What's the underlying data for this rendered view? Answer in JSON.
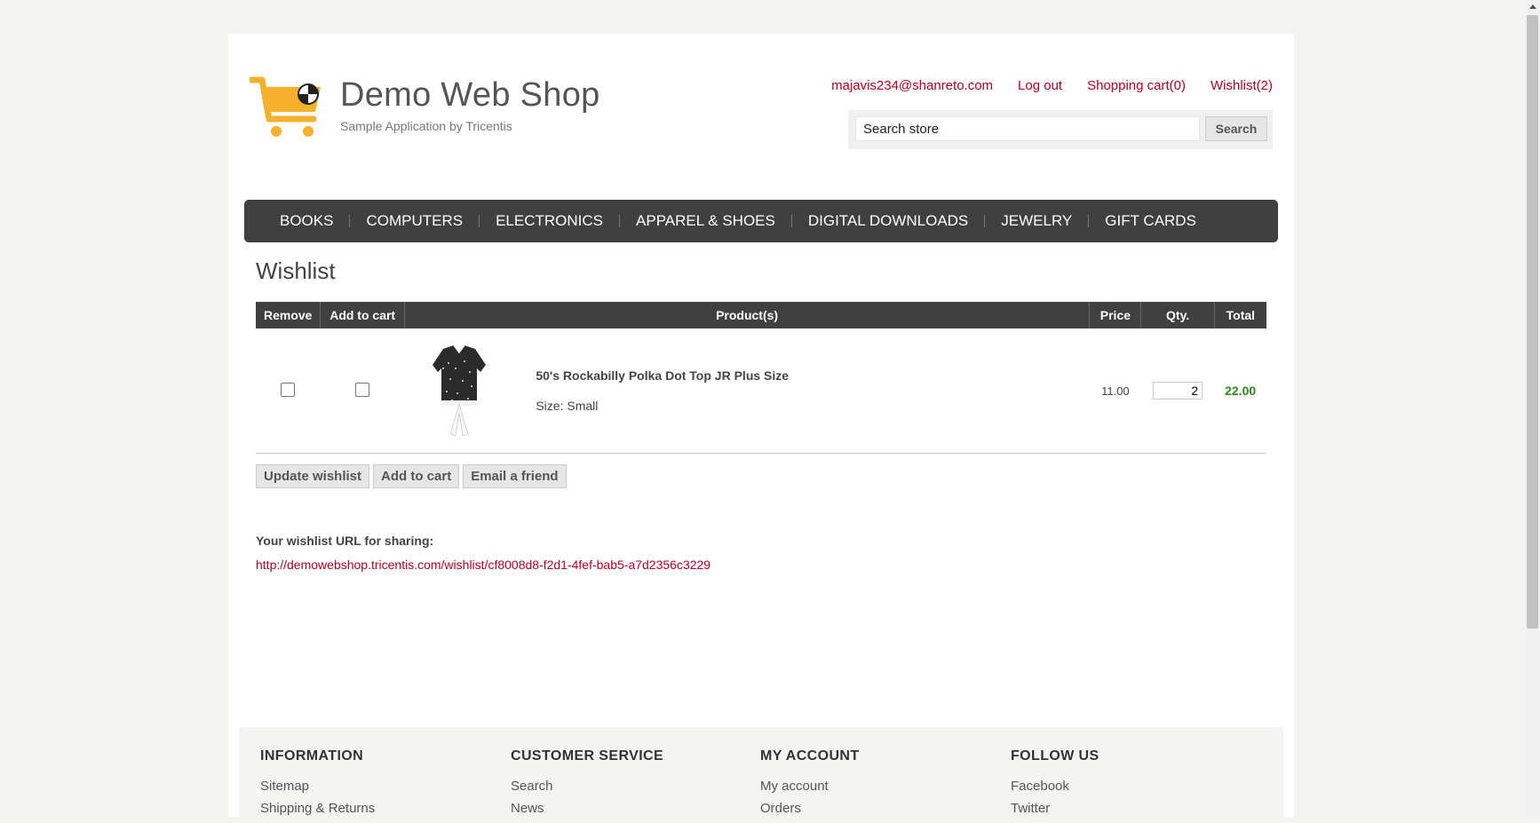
{
  "header": {
    "logo_title": "Demo Web Shop",
    "logo_subtitle": "Sample Application by Tricentis",
    "links": {
      "account": "majavis234@shanreto.com",
      "logout": "Log out",
      "cart": "Shopping cart(0)",
      "wishlist": "Wishlist(2)"
    },
    "search": {
      "value": "Search store",
      "button": "Search"
    }
  },
  "nav": [
    "BOOKS",
    "COMPUTERS",
    "ELECTRONICS",
    "APPAREL & SHOES",
    "DIGITAL DOWNLOADS",
    "JEWELRY",
    "GIFT CARDS"
  ],
  "main": {
    "title": "Wishlist",
    "table": {
      "headers": {
        "remove": "Remove",
        "add_to_cart": "Add to cart",
        "products": "Product(s)",
        "price": "Price",
        "qty": "Qty.",
        "total": "Total"
      },
      "rows": [
        {
          "name": "50's Rockabilly Polka Dot Top JR Plus Size",
          "attribute": "Size: Small",
          "price": "11.00",
          "qty": "2",
          "total": "22.00"
        }
      ]
    },
    "buttons": {
      "update": "Update wishlist",
      "add_to_cart": "Add to cart",
      "email": "Email a friend"
    },
    "share_label": "Your wishlist URL for sharing:",
    "share_url": "http://demowebshop.tricentis.com/wishlist/cf8008d8-f2d1-4fef-bab5-a7d2356c3229"
  },
  "footer": {
    "information": {
      "heading": "INFORMATION",
      "links": [
        "Sitemap",
        "Shipping & Returns"
      ]
    },
    "customer_service": {
      "heading": "CUSTOMER SERVICE",
      "links": [
        "Search",
        "News"
      ]
    },
    "my_account": {
      "heading": "MY ACCOUNT",
      "links": [
        "My account",
        "Orders"
      ]
    },
    "follow_us": {
      "heading": "FOLLOW US",
      "links": [
        "Facebook",
        "Twitter"
      ]
    }
  },
  "colors": {
    "link": "#b5001e",
    "nav_bg": "#404040",
    "total": "#2d8a1a",
    "logo_accent": "#f5b12b"
  }
}
